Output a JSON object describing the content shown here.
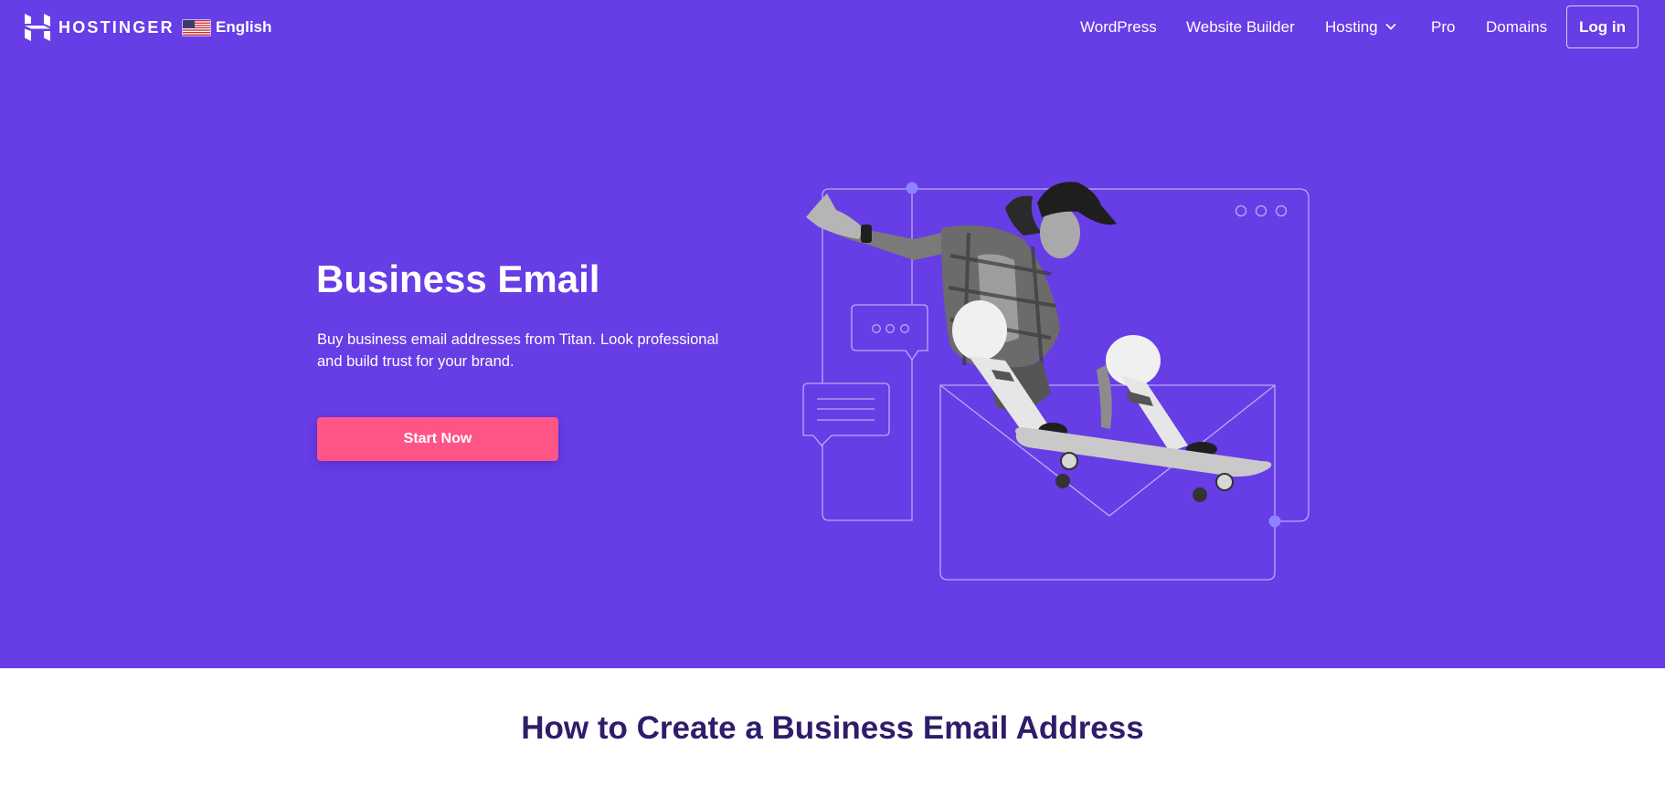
{
  "header": {
    "brand": "HOSTINGER",
    "logo_icon": "hostinger-logo-icon",
    "language": {
      "label": "English",
      "flag_icon": "us-flag-icon"
    },
    "nav": [
      {
        "label": "WordPress"
      },
      {
        "label": "Website Builder"
      },
      {
        "label": "Hosting",
        "has_dropdown": true,
        "icon": "chevron-down-icon"
      },
      {
        "label": "Pro"
      },
      {
        "label": "Domains"
      }
    ],
    "login_label": "Log in"
  },
  "hero": {
    "title": "Business Email",
    "description": "Buy business email addresses from Titan. Look professional and build trust for your brand.",
    "cta_label": "Start Now",
    "illustration": "skateboarder-with-email-graphics"
  },
  "section": {
    "title": "How to Create a Business Email Address"
  },
  "colors": {
    "hero_background": "#673DE6",
    "cta": "#FF5486",
    "heading_dark": "#2F1C6A",
    "line_art": "#B7ACF7",
    "accent_dot": "#8C85FF"
  }
}
